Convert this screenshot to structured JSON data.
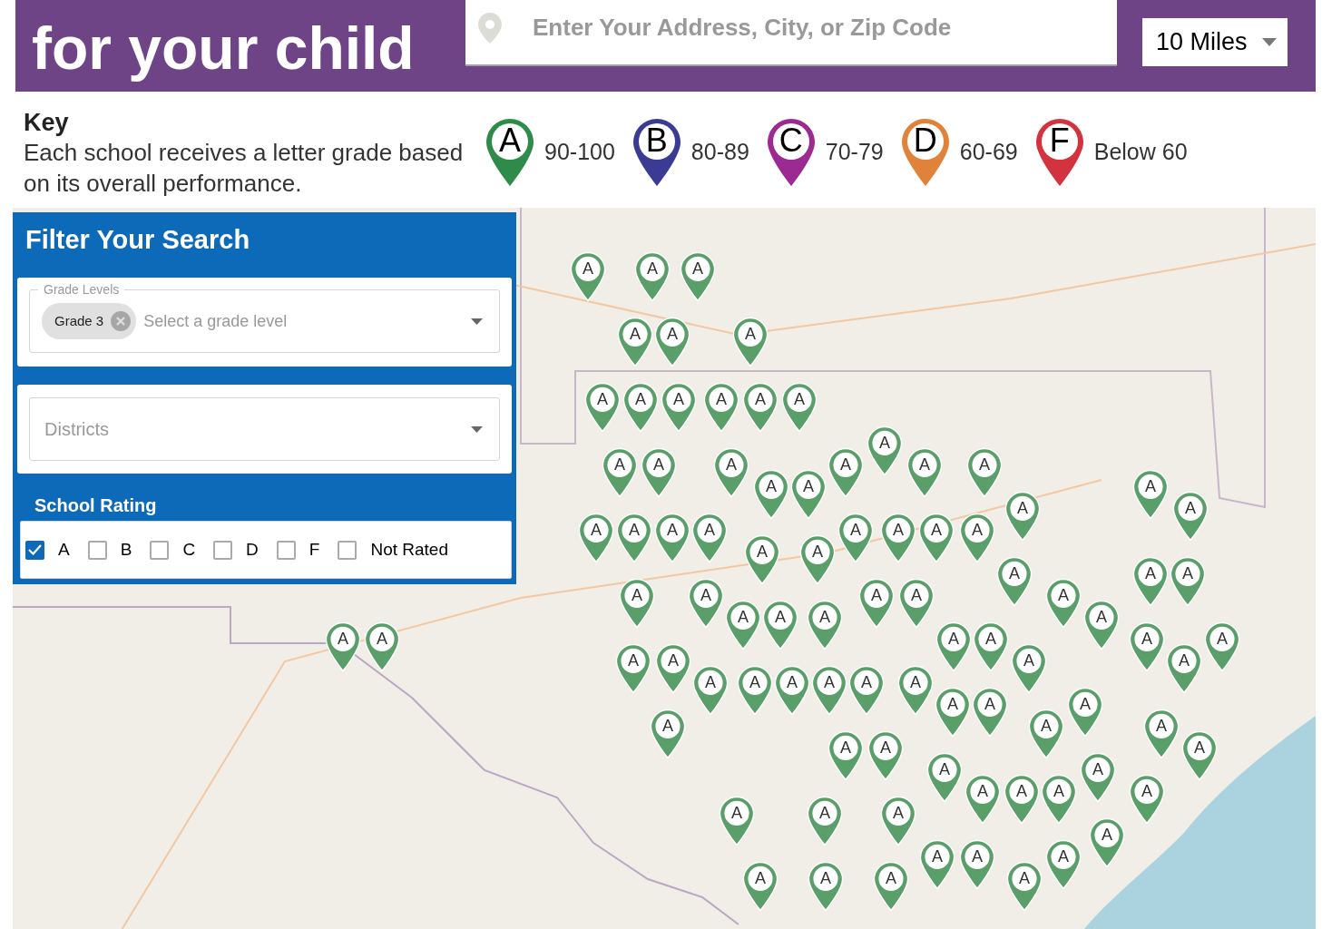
{
  "header": {
    "title": "for your child",
    "search": {
      "placeholder": "Enter Your Address, City, or Zip Code"
    },
    "radius": "10 Miles"
  },
  "key": {
    "heading": "Key",
    "description": "Each school receives a letter grade based on its overall performance.",
    "items": [
      {
        "grade": "A",
        "range": "90-100",
        "color": "#2e8b4a"
      },
      {
        "grade": "B",
        "range": "80-89",
        "color": "#3b3b94"
      },
      {
        "grade": "C",
        "range": "70-79",
        "color": "#9c2a93"
      },
      {
        "grade": "D",
        "range": "60-69",
        "color": "#e0823a"
      },
      {
        "grade": "F",
        "range": "Below 60",
        "color": "#d3323f"
      }
    ]
  },
  "filter": {
    "title": "Filter Your Search",
    "grade_levels": {
      "label": "Grade Levels",
      "chips": [
        "Grade 3"
      ],
      "placeholder": "Select a grade level"
    },
    "districts": {
      "placeholder": "Districts"
    },
    "rating": {
      "title": "School Rating",
      "options": [
        {
          "label": "A",
          "checked": true
        },
        {
          "label": "B",
          "checked": false
        },
        {
          "label": "C",
          "checked": false
        },
        {
          "label": "D",
          "checked": false
        },
        {
          "label": "F",
          "checked": false
        },
        {
          "label": "Not Rated",
          "checked": false
        }
      ]
    }
  },
  "map": {
    "pins": [
      {
        "grade": "A"
      },
      {
        "grade": "A"
      },
      {
        "grade": "A"
      },
      {
        "grade": "A"
      },
      {
        "grade": "A"
      },
      {
        "grade": "A"
      },
      {
        "grade": "A"
      },
      {
        "grade": "A"
      },
      {
        "grade": "A"
      },
      {
        "grade": "A"
      },
      {
        "grade": "A"
      },
      {
        "grade": "A"
      },
      {
        "grade": "A"
      },
      {
        "grade": "A"
      },
      {
        "grade": "A"
      },
      {
        "grade": "A"
      },
      {
        "grade": "A"
      },
      {
        "grade": "A"
      },
      {
        "grade": "A"
      },
      {
        "grade": "A"
      },
      {
        "grade": "A"
      },
      {
        "grade": "A"
      },
      {
        "grade": "A"
      },
      {
        "grade": "A"
      },
      {
        "grade": "A"
      },
      {
        "grade": "A"
      },
      {
        "grade": "A"
      },
      {
        "grade": "A"
      },
      {
        "grade": "A"
      },
      {
        "grade": "A"
      },
      {
        "grade": "A"
      },
      {
        "grade": "A"
      },
      {
        "grade": "A"
      },
      {
        "grade": "A"
      },
      {
        "grade": "A"
      },
      {
        "grade": "A"
      },
      {
        "grade": "A"
      },
      {
        "grade": "A"
      },
      {
        "grade": "A"
      },
      {
        "grade": "A"
      },
      {
        "grade": "A"
      },
      {
        "grade": "A"
      },
      {
        "grade": "A"
      },
      {
        "grade": "A"
      },
      {
        "grade": "A"
      },
      {
        "grade": "A"
      },
      {
        "grade": "A"
      },
      {
        "grade": "A"
      },
      {
        "grade": "A"
      },
      {
        "grade": "A"
      },
      {
        "grade": "A"
      },
      {
        "grade": "A"
      },
      {
        "grade": "A"
      },
      {
        "grade": "A"
      },
      {
        "grade": "A"
      },
      {
        "grade": "A"
      },
      {
        "grade": "A"
      },
      {
        "grade": "A"
      },
      {
        "grade": "A"
      },
      {
        "grade": "A"
      },
      {
        "grade": "A"
      },
      {
        "grade": "A"
      },
      {
        "grade": "A"
      },
      {
        "grade": "A"
      },
      {
        "grade": "A"
      },
      {
        "grade": "A"
      },
      {
        "grade": "A"
      },
      {
        "grade": "A"
      },
      {
        "grade": "A"
      },
      {
        "grade": "A"
      },
      {
        "grade": "A"
      },
      {
        "grade": "A"
      },
      {
        "grade": "A"
      },
      {
        "grade": "A"
      },
      {
        "grade": "A"
      },
      {
        "grade": "A"
      },
      {
        "grade": "A"
      },
      {
        "grade": "A"
      },
      {
        "grade": "A"
      },
      {
        "grade": "A"
      },
      {
        "grade": "A"
      },
      {
        "grade": "A"
      },
      {
        "grade": "A"
      },
      {
        "grade": "A"
      },
      {
        "grade": "A"
      },
      {
        "grade": "A"
      },
      {
        "grade": "A"
      },
      {
        "grade": "A"
      }
    ]
  }
}
